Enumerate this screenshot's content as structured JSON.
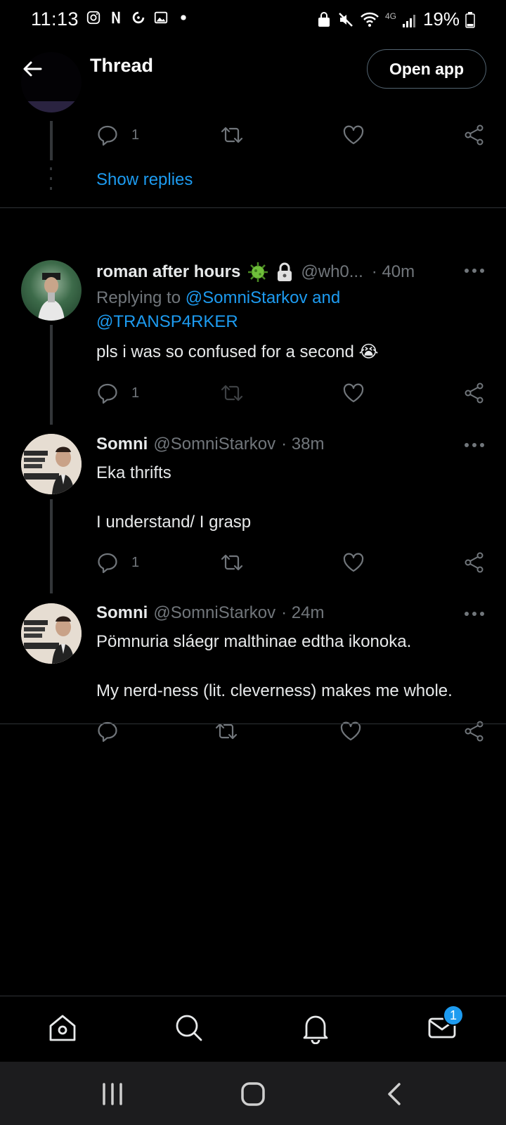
{
  "status_bar": {
    "time": "11:13",
    "network": "4G",
    "battery_percent": "19%"
  },
  "header": {
    "title": "Thread",
    "open_app_label": "Open app"
  },
  "top_fragment": {
    "reply_count": "1",
    "show_replies_label": "Show replies"
  },
  "tweets": [
    {
      "name": "roman after hours",
      "handle": "@wh0...",
      "time": "· 40m",
      "replying_prefix": "Replying to",
      "replying_line1": "@SomniStarkov and",
      "replying_line2": "@TRANSP4RKER",
      "text": "pls i was so confused for a second 😭",
      "reply_count": "1"
    },
    {
      "name": "Somni",
      "handle": "@SomniStarkov",
      "time": "· 38m",
      "text_line1": "Eka thrifts",
      "text_line2": "I understand/ I grasp",
      "reply_count": "1"
    },
    {
      "name": "Somni",
      "handle": "@SomniStarkov",
      "time": "· 24m",
      "text_line1": "Pömnuria sláegr malthinae edtha ikonoka.",
      "text_line2": "My nerd-ness (lit. cleverness) makes me whole.",
      "reply_count": ""
    }
  ],
  "bottom_nav": {
    "messages_badge": "1"
  },
  "colors": {
    "accent": "#1d9bf0",
    "background": "#000000",
    "secondary_text": "#71767b"
  }
}
